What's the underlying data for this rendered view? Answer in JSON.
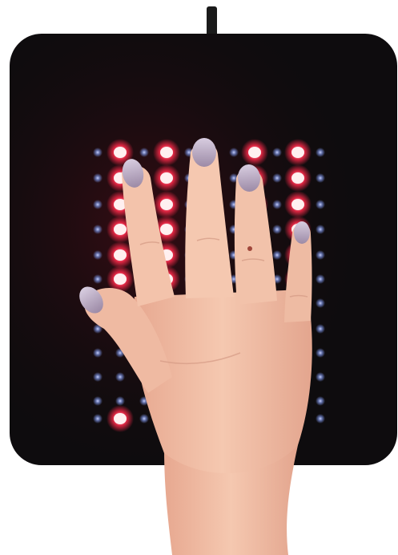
{
  "photo": {
    "subject": "hand-on-led-light-therapy-pad",
    "background_color": "#ffffff",
    "pad_color": "#0e0c0e",
    "cable_color": "#1a1a1a",
    "red_led_color": "#ff2a4a",
    "red_led_core_color": "#fff0f0",
    "infrared_led_color": "#6a7cc0",
    "skin_color": "#f2c0a6",
    "skin_shadow_color": "#d99b86",
    "nail_polish_color": "#b9a7bf"
  }
}
